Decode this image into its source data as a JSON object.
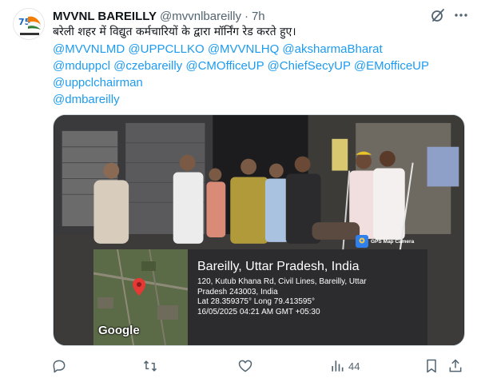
{
  "tweet": {
    "author_name": "MVVNL BAREILLY",
    "handle": "@mvvnlbareilly",
    "separator": "·",
    "time": "7h",
    "text_lines": [
      "बरेली शहर में विद्युत कर्मचारियों के द्वारा मॉर्निंग रेड करते हुए।",
      "@MVVNLMD @UPPCLLKO @MVVNLHQ @aksharmaBharat",
      "@mduppcl @czebareilly @CMOfficeUP @ChiefSecyUP @EMofficeUP",
      "@uppclchairman",
      "@dmbareilly"
    ]
  },
  "media": {
    "photo_description_icon": "group-photo",
    "gps_badge_label": "GPS Map Camera",
    "map_label": "Google",
    "location_title": "Bareilly, Uttar Pradesh, India",
    "address_line1": "120, Kutub Khana Rd, Civil Lines, Bareilly, Uttar",
    "address_line2": "Pradesh 243003, India",
    "coordinates": "Lat 28.359375° Long 79.413595°",
    "timestamp": "16/05/2025 04:21 AM GMT +05:30"
  },
  "actions": {
    "reply_icon": "reply-icon",
    "retweet_icon": "retweet-icon",
    "like_icon": "like-icon",
    "views_icon": "views-icon",
    "views_count": "44",
    "bookmark_icon": "bookmark-icon",
    "share_icon": "share-icon"
  },
  "colors": {
    "link": "#1d9bf0",
    "secondary_text": "#536471",
    "primary_text": "#0f1419",
    "border": "#cfd9de"
  }
}
